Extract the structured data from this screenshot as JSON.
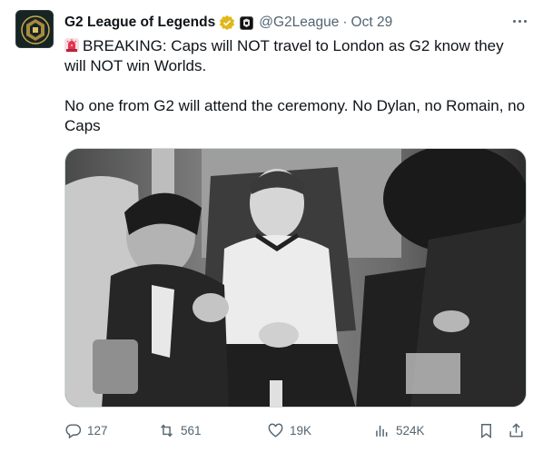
{
  "tweet": {
    "author_name": "G2 League of Legends",
    "handle": "@G2League",
    "separator": "·",
    "date": "Oct 29",
    "text_line1": "BREAKING: Caps will NOT travel to London as G2 know they will NOT win Worlds.",
    "text_line2": "No one from G2 will attend the ceremony. No Dylan, no Romain, no Caps",
    "icons": {
      "verified": "verified-badge-gold-icon",
      "affiliate": "g2-affiliate-icon",
      "siren": "siren-emoji-icon",
      "more": "more-icon"
    }
  },
  "actions": {
    "replies": "127",
    "reposts": "561",
    "likes": "19K",
    "views": "524K"
  },
  "colors": {
    "text": "#0f1419",
    "secondary": "#536471",
    "verified_gold": "#e2b719",
    "border": "#cfd9de"
  }
}
